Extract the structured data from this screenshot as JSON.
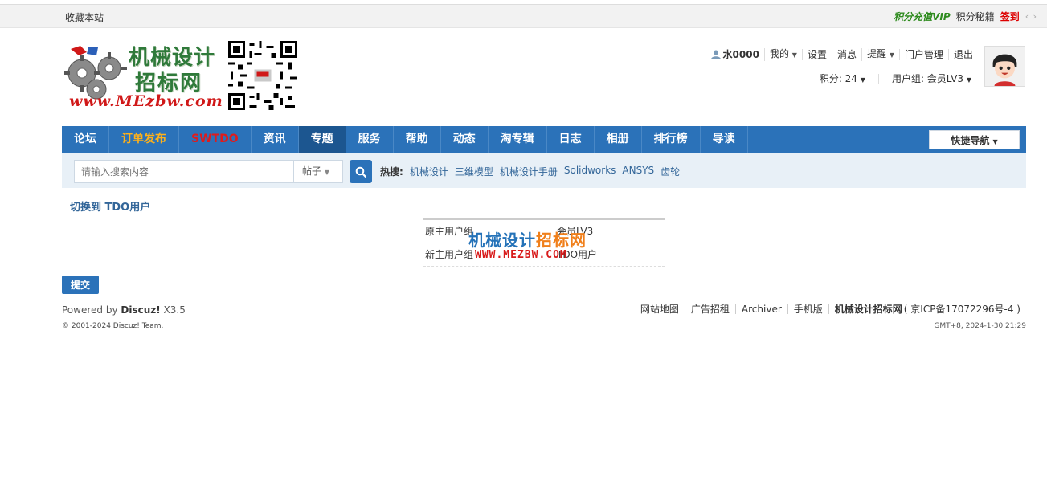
{
  "topbar": {
    "favorite": "收藏本站",
    "vip": "积分充值VIP",
    "secret": "积分秘籍",
    "sign": "签到",
    "arrows": "‹ ›"
  },
  "logo": {
    "line1": "机械设计",
    "line2": "招标网",
    "line3": "www.MEzbw.com"
  },
  "user": {
    "name": "水0000",
    "mine": "我的",
    "settings": "设置",
    "messages": "消息",
    "remind": "提醒",
    "portal": "门户管理",
    "logout": "退出",
    "points": "积分: 24",
    "group": "用户组: 会员LV3"
  },
  "nav": {
    "items": [
      {
        "label": "论坛",
        "style": "normal"
      },
      {
        "label": "订单发布",
        "style": "orange"
      },
      {
        "label": "SWTDO",
        "style": "red"
      },
      {
        "label": "资讯",
        "style": "normal"
      },
      {
        "label": "专题",
        "style": "active"
      },
      {
        "label": "服务",
        "style": "normal"
      },
      {
        "label": "帮助",
        "style": "normal"
      },
      {
        "label": "动态",
        "style": "normal"
      },
      {
        "label": "淘专辑",
        "style": "normal"
      },
      {
        "label": "日志",
        "style": "normal"
      },
      {
        "label": "相册",
        "style": "normal"
      },
      {
        "label": "排行榜",
        "style": "normal"
      },
      {
        "label": "导读",
        "style": "normal"
      }
    ],
    "quick": "快捷导航"
  },
  "search": {
    "placeholder": "请输入搜索内容",
    "type": "帖子",
    "hot_label": "热搜:",
    "hot": [
      "机械设计",
      "三维模型",
      "机械设计手册",
      "Solidworks",
      "ANSYS",
      "齿轮"
    ]
  },
  "content": {
    "title": "切换到 TDO用户",
    "rows": [
      {
        "key": "原主用户组",
        "value": "会员LV3"
      },
      {
        "key": "新主用户组",
        "value": "TDO用户"
      }
    ],
    "watermark_cn_a": "机械设计",
    "watermark_cn_b": "招标网",
    "watermark_en": "WWW.MEZBW.COM",
    "submit": "提交"
  },
  "footer": {
    "powered_pre": "Powered by ",
    "powered_brand": "Discuz!",
    "powered_ver": " X3.5",
    "copyright": "© 2001-2024 Discuz! Team.",
    "links": [
      "网站地图",
      "广告招租",
      "Archiver",
      "手机版"
    ],
    "site": "机械设计招标网",
    "icp": "( 京ICP备17072296号-4 )",
    "gmt": "GMT+8, 2024-1-30 21:29"
  },
  "colors": {
    "nav_bg": "#2b72b9",
    "nav_active": "#1c5690",
    "vip_green": "#2e8b1e",
    "sign_red": "#dd0000"
  }
}
